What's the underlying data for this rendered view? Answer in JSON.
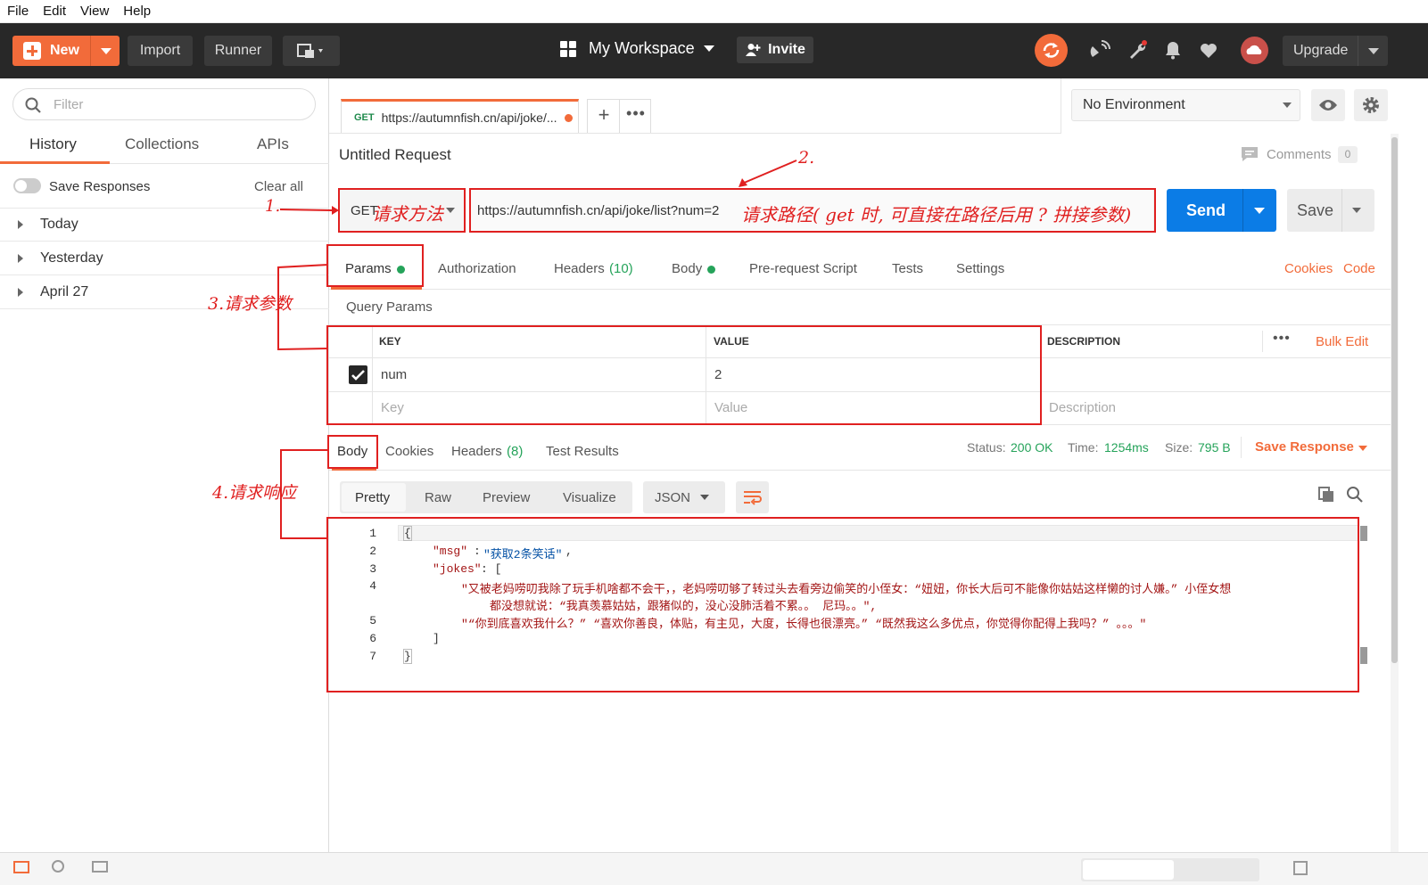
{
  "menu": [
    "File",
    "Edit",
    "View",
    "Help"
  ],
  "header": {
    "new": "New",
    "import": "Import",
    "runner": "Runner",
    "workspace": "My Workspace",
    "invite": "Invite",
    "upgrade": "Upgrade",
    "accent": "#f26b3a"
  },
  "sidebar": {
    "filter_placeholder": "Filter",
    "tabs": [
      "History",
      "Collections",
      "APIs"
    ],
    "save_responses": "Save Responses",
    "clear_all": "Clear all",
    "groups": [
      "Today",
      "Yesterday",
      "April 27"
    ]
  },
  "request": {
    "tab_method": "GET",
    "tab_url": "https://autumnfish.cn/api/joke/...",
    "environment": "No Environment",
    "title": "Untitled Request",
    "comments": "Comments",
    "comments_count": "0",
    "method": "GET",
    "url": "https://autumnfish.cn/api/joke/list?num=2",
    "send": "Send",
    "save": "Save"
  },
  "req_tabs": {
    "params": "Params",
    "authorization": "Authorization",
    "headers": "Headers",
    "headers_count": "(10)",
    "body": "Body",
    "prerequest": "Pre-request Script",
    "tests": "Tests",
    "settings": "Settings",
    "cookies": "Cookies",
    "code": "Code"
  },
  "query": {
    "title": "Query Params",
    "col_key": "KEY",
    "col_value": "VALUE",
    "col_desc": "DESCRIPTION",
    "bulk_edit": "Bulk Edit",
    "row_key": "num",
    "row_value": "2",
    "ph_key": "Key",
    "ph_value": "Value",
    "ph_desc": "Description"
  },
  "response": {
    "tabs": [
      "Body",
      "Cookies",
      "Headers",
      "Test Results"
    ],
    "headers_count": "(8)",
    "status_label": "Status:",
    "status": "200 OK",
    "time_label": "Time:",
    "time": "1254ms",
    "size_label": "Size:",
    "size": "795 B",
    "save_response": "Save Response",
    "views": [
      "Pretty",
      "Raw",
      "Preview",
      "Visualize"
    ],
    "format": "JSON",
    "line_numbers": [
      "1",
      "2",
      "3",
      "4",
      "",
      "5",
      "6",
      "7"
    ],
    "code": {
      "l1": "{",
      "msg_key": "\"msg\"",
      "msg_val": "\"获取2条笑话\"",
      "jokes_key": "\"jokes\"",
      "joke1a": "\"又被老妈唠叨我除了玩手机啥都不会干，，老妈唠叨够了转过头去看旁边偷笑的小侄女：“妞妞，你长大后可不能像你姑姑这样懒的讨人嫌。” 小侄女想",
      "joke1b": "都没想就说：“我真羡慕姑姑，跟猪似的，没心没肺活着不累。。 尼玛。。\",",
      "joke2": "\"“你到底喜欢我什么？” “喜欢你善良，体贴，有主见，大度，长得也很漂亮。” “既然我这么多优点，你觉得你配得上我吗？” 。。。\"",
      "l6": "]",
      "l7": "}"
    }
  },
  "annotations": {
    "a1": "1.",
    "a1_text": "请求方法",
    "a2": "2.",
    "a2_text": "请求路径( get 时, 可直接在路径后用 ? 拼接参数)",
    "a3": "3.请求参数",
    "a4": "4.请求响应",
    "color": "#e02020"
  }
}
